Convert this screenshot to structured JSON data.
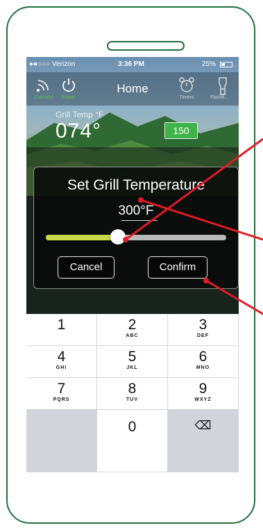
{
  "status": {
    "carrier": "●●○○○ Verizon",
    "time": "3:36 PM",
    "battery": "25%"
  },
  "nav": {
    "title": "Home",
    "connect_label": "Connect",
    "power_label": "Power",
    "timers_label": "Timers",
    "flashlight_label": "Flashli..."
  },
  "grill": {
    "label": "Grill Temp °F",
    "value": "074°",
    "setpoint": "150"
  },
  "dialog": {
    "title": "Set Grill Temperature",
    "value": "300°F",
    "slider_fraction": 0.4,
    "cancel_label": "Cancel",
    "confirm_label": "Confirm"
  },
  "keypad": {
    "keys": [
      {
        "num": "1",
        "letters": ""
      },
      {
        "num": "2",
        "letters": "ABC"
      },
      {
        "num": "3",
        "letters": "DEF"
      },
      {
        "num": "4",
        "letters": "GHI"
      },
      {
        "num": "5",
        "letters": "JKL"
      },
      {
        "num": "6",
        "letters": "MNO"
      },
      {
        "num": "7",
        "letters": "PQRS"
      },
      {
        "num": "8",
        "letters": "TUV"
      },
      {
        "num": "9",
        "letters": "WXYZ"
      },
      {
        "num": "",
        "letters": ""
      },
      {
        "num": "0",
        "letters": ""
      },
      {
        "num": "⌫",
        "letters": ""
      }
    ]
  },
  "colors": {
    "frame": "#1f6f3c",
    "accent_green": "#3fb34a",
    "slider_fill": "#c6d94a",
    "annotation_red": "#e01b24"
  }
}
